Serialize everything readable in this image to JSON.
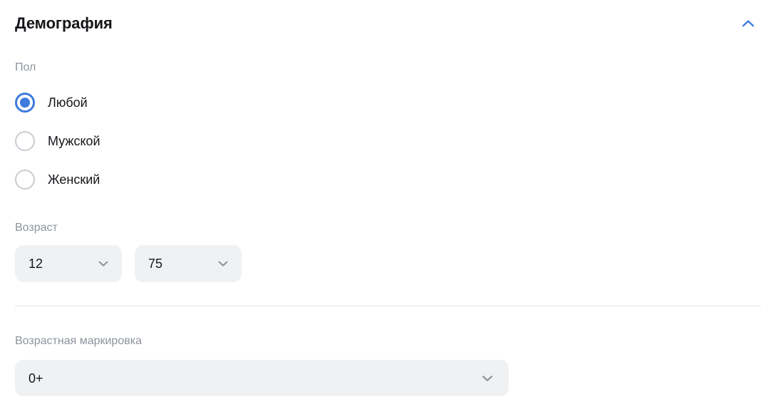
{
  "section": {
    "title": "Демография",
    "collapse_icon": "chevron-up-icon",
    "accent_color": "#3d7bdd"
  },
  "gender": {
    "label": "Пол",
    "selected": "Любой",
    "options": [
      {
        "label": "Любой",
        "checked": true
      },
      {
        "label": "Мужской",
        "checked": false
      },
      {
        "label": "Женский",
        "checked": false
      }
    ]
  },
  "age": {
    "label": "Возраст",
    "from": {
      "value": "12",
      "caret_icon": "chevron-down-icon"
    },
    "to": {
      "value": "75",
      "caret_icon": "chevron-down-icon"
    }
  },
  "age_rating": {
    "label": "Возрастная маркировка",
    "value": "0+",
    "caret_icon": "chevron-down-icon"
  },
  "colors": {
    "accent": "#3d7bdd",
    "label_gray": "#8e939c",
    "text_dark": "#16171b",
    "field_bg": "#f0f1f3",
    "divider": "#e3e4e7",
    "radio_unchecked": "#c9ccd2"
  }
}
